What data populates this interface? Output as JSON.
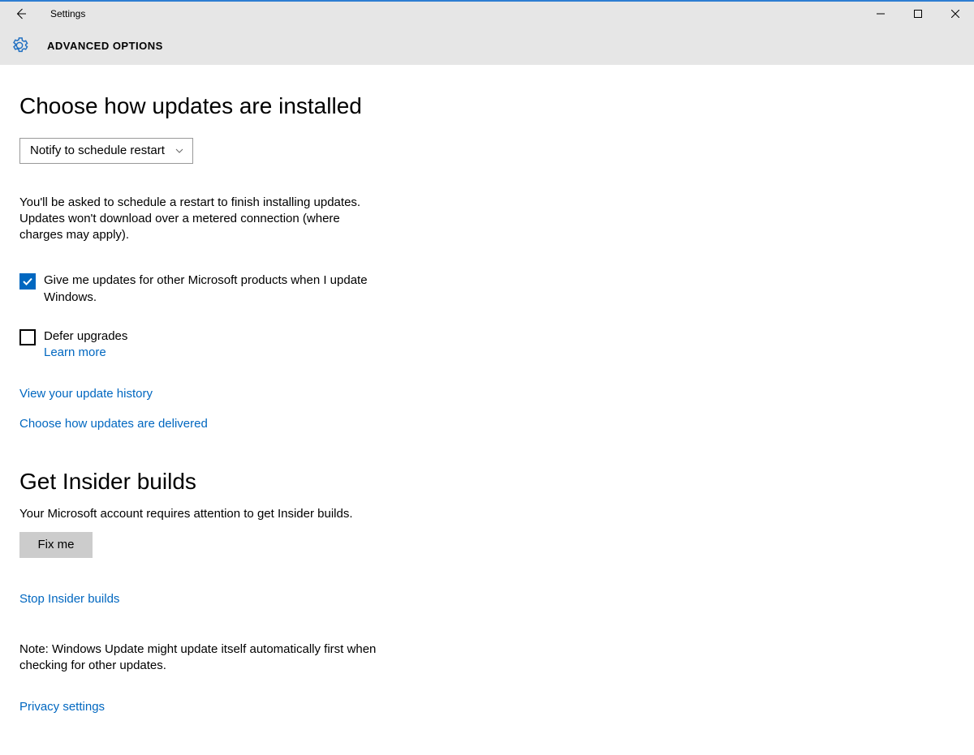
{
  "window": {
    "title": "Settings",
    "subtitle": "ADVANCED OPTIONS"
  },
  "main": {
    "heading1": "Choose how updates are installed",
    "dropdown_value": "Notify to schedule restart",
    "restart_desc": "You'll be asked to schedule a restart to finish installing updates. Updates won't download over a metered connection (where charges may apply).",
    "cb_other_products": {
      "checked": true,
      "label": "Give me updates for other Microsoft products when I update Windows."
    },
    "cb_defer": {
      "checked": false,
      "label": "Defer upgrades",
      "learn_more": "Learn more"
    },
    "link_history": "View your update history",
    "link_delivered": "Choose how updates are delivered",
    "heading2": "Get Insider builds",
    "insider_desc": "Your Microsoft account requires attention to get Insider builds.",
    "fixme_label": "Fix me",
    "link_stop": "Stop Insider builds",
    "note": "Note: Windows Update might update itself automatically first when checking for other updates.",
    "link_privacy": "Privacy settings"
  }
}
